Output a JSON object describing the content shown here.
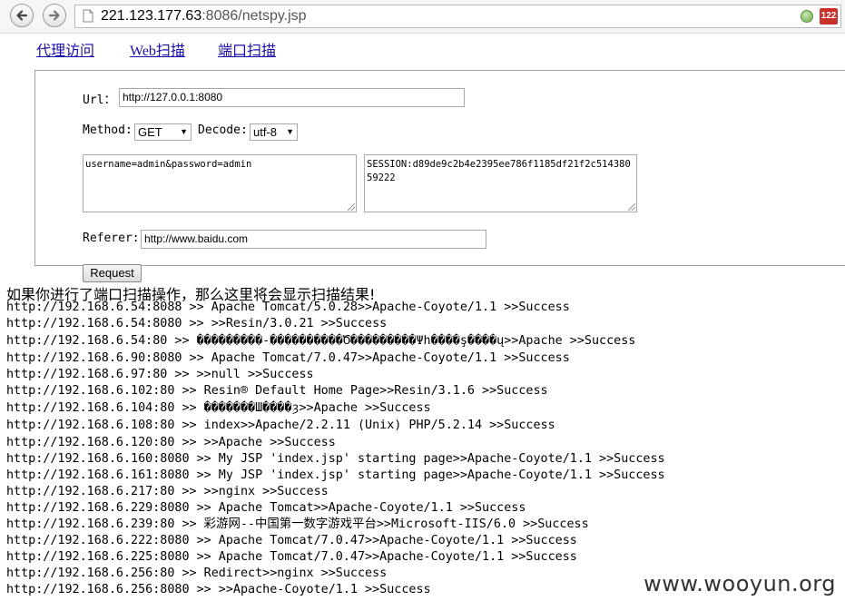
{
  "browser": {
    "url_host": "221.123.177.63",
    "url_rest": ":8086/netspy.jsp",
    "extension_badge": "122"
  },
  "nav": {
    "proxy": "代理访问",
    "web_scan": "Web扫描",
    "port_scan": "端口扫描"
  },
  "form": {
    "url_label": "Url：",
    "url_value": "http://127.0.0.1:8080",
    "method_label": "Method:",
    "method_value": "GET",
    "decode_label": "Decode:",
    "decode_value": "utf-8",
    "post_data": "username=admin&password=admin",
    "cookie": "SESSION:d89de9c2b4e2395ee786f1185df21f2c51438059222",
    "referer_label": "Referer:",
    "referer_value": "http://www.baidu.com",
    "submit_label": "Request"
  },
  "results": {
    "intro": "如果你进行了端口扫描操作，那么这里将会显示扫描结果!",
    "lines": [
      "http://192.168.6.54:8088 >> Apache Tomcat/5.0.28>>Apache-Coyote/1.1 >>Success",
      "http://192.168.6.54:8080 >> >>Resin/3.0.21 >>Success",
      "http://192.168.6.54:80 >> ���������-����������Ծ���������Ψh����ş����ų>>Apache >>Success",
      "http://192.168.6.90:8080 >> Apache Tomcat/7.0.47>>Apache-Coyote/1.1 >>Success",
      "http://192.168.6.97:80 >> >>null >>Success",
      "http://192.168.6.102:80 >> Resin® Default Home Page>>Resin/3.1.6 >>Success",
      "http://192.168.6.104:80 >> �������Ш����ȝ>>Apache >>Success",
      "http://192.168.6.108:80 >> index>>Apache/2.2.11 (Unix) PHP/5.2.14 >>Success",
      "http://192.168.6.120:80 >> >>Apache >>Success",
      "http://192.168.6.160:8080 >> My JSP 'index.jsp' starting page>>Apache-Coyote/1.1 >>Success",
      "http://192.168.6.161:8080 >> My JSP 'index.jsp' starting page>>Apache-Coyote/1.1 >>Success",
      "http://192.168.6.217:80 >> >>nginx >>Success",
      "http://192.168.6.229:8080 >> Apache Tomcat>>Apache-Coyote/1.1 >>Success",
      "http://192.168.6.239:80 >> 彩游网--中国第一数字游戏平台>>Microsoft-IIS/6.0 >>Success",
      "http://192.168.6.222:8080 >> Apache Tomcat/7.0.47>>Apache-Coyote/1.1 >>Success",
      "http://192.168.6.225:8080 >> Apache Tomcat/7.0.47>>Apache-Coyote/1.1 >>Success",
      "http://192.168.6.256:80 >> Redirect>>nginx >>Success",
      "http://192.168.6.256:8080 >> >>Apache-Coyote/1.1 >>Success"
    ]
  },
  "watermark": "www.wooyun.org"
}
